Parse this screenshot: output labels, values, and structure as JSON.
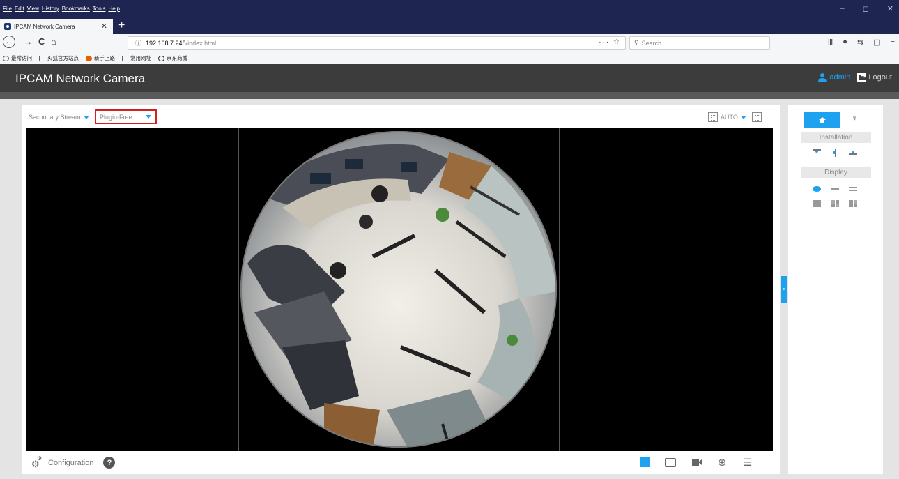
{
  "browser": {
    "menu": [
      "File",
      "Edit",
      "View",
      "History",
      "Bookmarks",
      "Tools",
      "Help"
    ],
    "window_controls": [
      "–",
      "◻",
      "✕"
    ],
    "tab_title": "IPCAM Network Camera",
    "tab_close": "✕",
    "new_tab": "+",
    "nav": {
      "back": "←",
      "forward": "→",
      "reload": "C",
      "home": "⌂"
    },
    "url_info": "ⓘ",
    "url_host": "192.168.7.248",
    "url_path": "/index.html",
    "url_tools": "··· ☆",
    "search_placeholder": "Search",
    "search_icon": "⚲",
    "toolbar_icons": [
      "library-icon",
      "chat-icon",
      "sync-icon",
      "sidebar-icon",
      "menu-icon"
    ],
    "toolbar_glyphs": [
      "Ⅲ",
      "●",
      "⇆",
      "◫",
      "≡"
    ],
    "bookmarks": [
      "最常访问",
      "火狐官方站点",
      "新手上路",
      "常用网址",
      "京东商城"
    ]
  },
  "app": {
    "title": "IPCAM Network Camera",
    "user": "admin",
    "logout": "Logout",
    "accent_color": "#1ea1ef",
    "highlight_color": "#d62020"
  },
  "live": {
    "stream": "Secondary Stream",
    "mode": "Plugin-Free",
    "ratio": "AUTO",
    "config_label": "Configuration",
    "help": "?",
    "zoom_glyph": "⊕",
    "settings_glyph": "☰",
    "collapse_glyph": ">"
  },
  "side": {
    "ptz_glyph": "♆",
    "installation": "Installation",
    "display": "Display"
  }
}
